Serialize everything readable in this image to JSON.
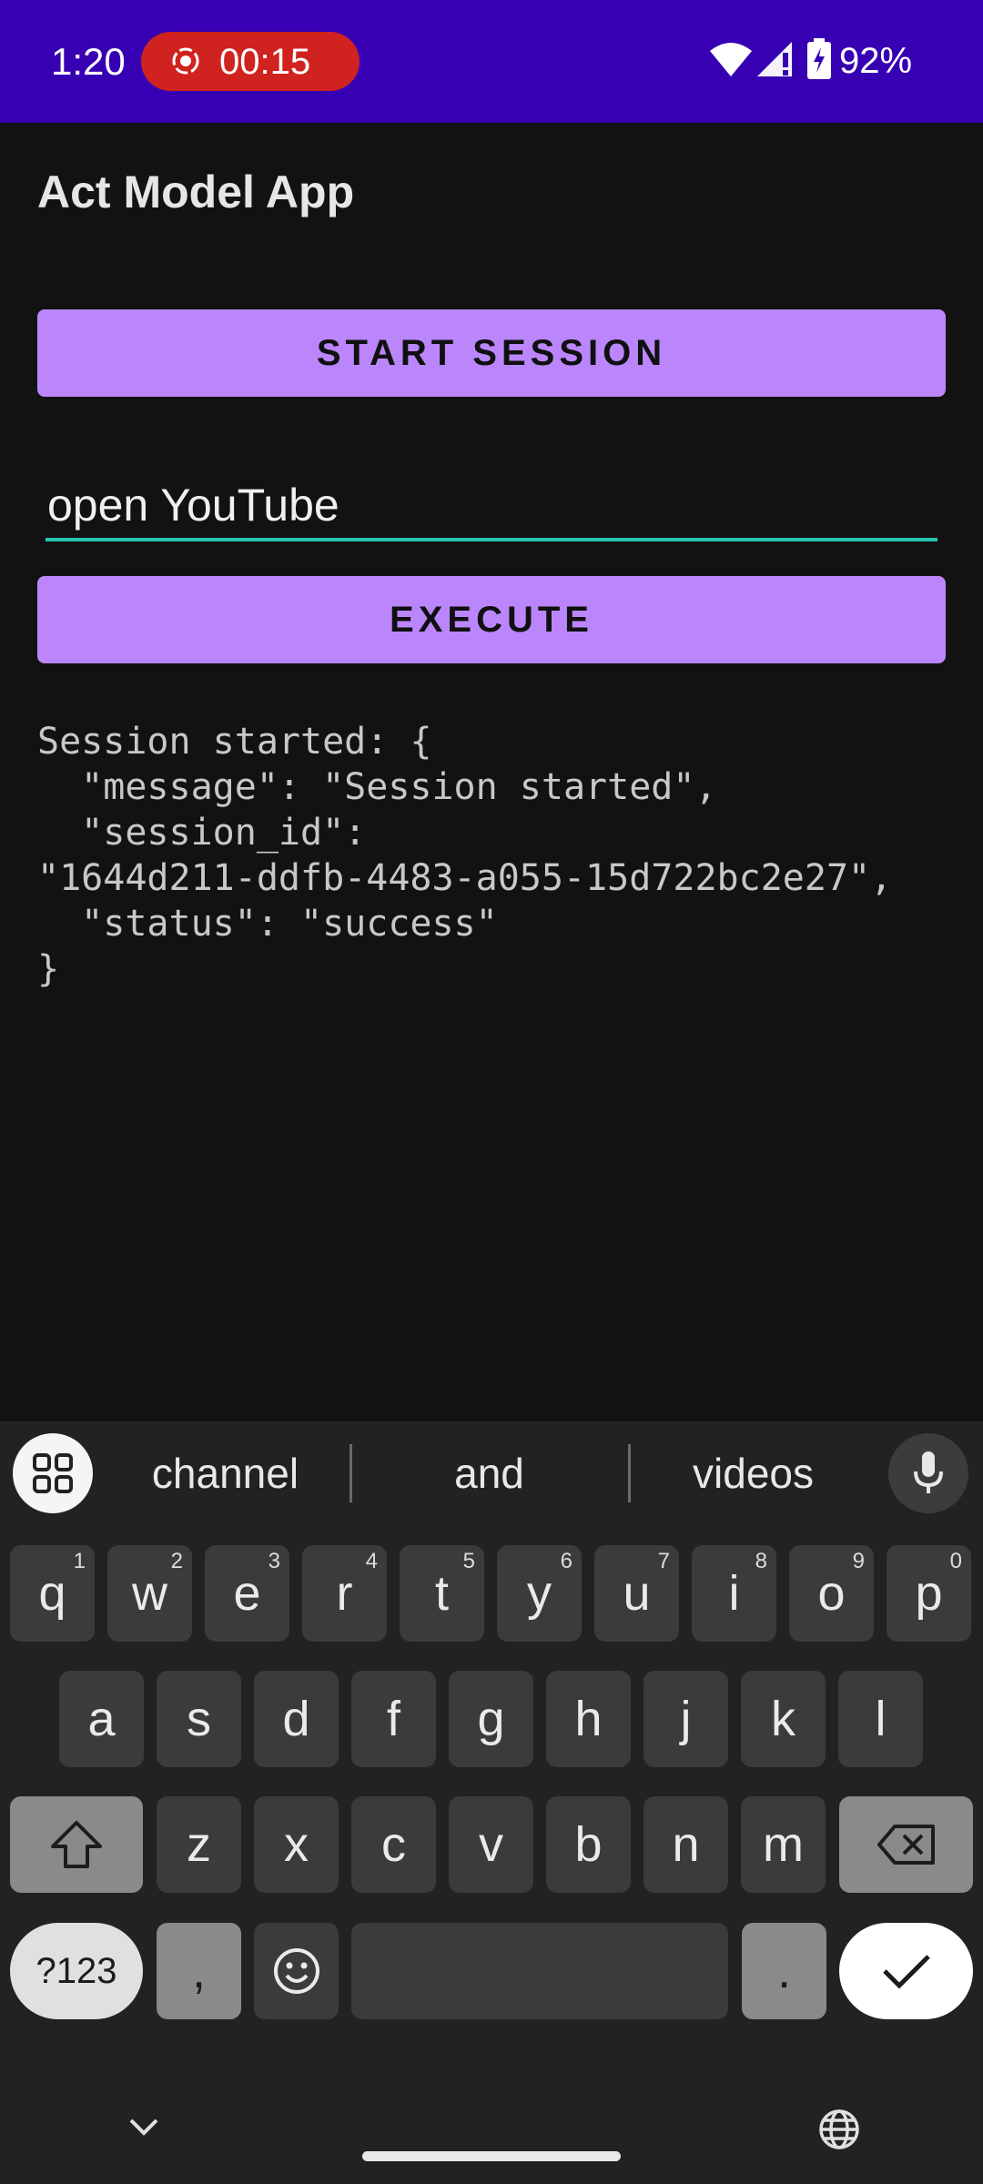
{
  "status_bar": {
    "time": "1:20",
    "recording_timer": "00:15",
    "battery_percent": "92%"
  },
  "app": {
    "title": "Act Model App",
    "start_session_label": "START SESSION",
    "command_input_value": "open YouTube",
    "execute_label": "EXECUTE",
    "output_text": "Session started: {\n  \"message\": \"Session started\",\n  \"session_id\":\n\"1644d211-ddfb-4483-a055-15d722bc2e27\",\n  \"status\": \"success\"\n}"
  },
  "keyboard": {
    "suggestions": [
      "channel",
      "and",
      "videos"
    ],
    "row1": [
      {
        "k": "q",
        "n": "1"
      },
      {
        "k": "w",
        "n": "2"
      },
      {
        "k": "e",
        "n": "3"
      },
      {
        "k": "r",
        "n": "4"
      },
      {
        "k": "t",
        "n": "5"
      },
      {
        "k": "y",
        "n": "6"
      },
      {
        "k": "u",
        "n": "7"
      },
      {
        "k": "i",
        "n": "8"
      },
      {
        "k": "o",
        "n": "9"
      },
      {
        "k": "p",
        "n": "0"
      }
    ],
    "row2": [
      "a",
      "s",
      "d",
      "f",
      "g",
      "h",
      "j",
      "k",
      "l"
    ],
    "row3": [
      "z",
      "x",
      "c",
      "v",
      "b",
      "n",
      "m"
    ],
    "symbols_label": "?123",
    "comma": ",",
    "period": "."
  },
  "colors": {
    "status_bar": "#3700b3",
    "button": "#bb86fc",
    "input_underline": "#26c6b4",
    "record_pill": "#d0231f"
  }
}
